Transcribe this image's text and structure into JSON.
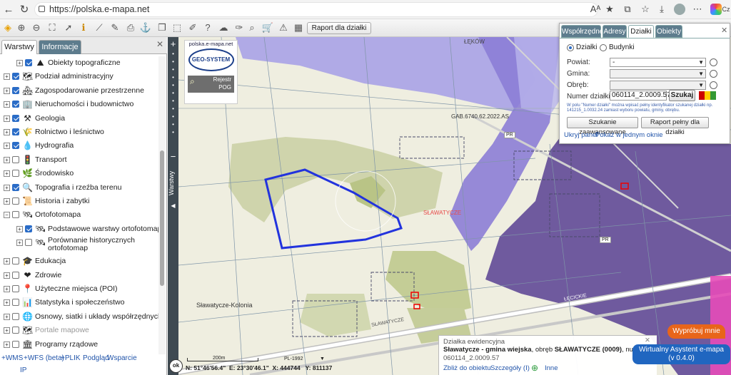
{
  "browser": {
    "url": "https://polska.e-mapa.net",
    "profile_label": "Cz"
  },
  "toolbar": {
    "raport_label": "Raport dla działki"
  },
  "left_panel": {
    "tabs": [
      "Warstwy",
      "Informacje"
    ],
    "layers": [
      {
        "label": "Obiekty topograficzne",
        "checked": true,
        "expander": "+",
        "icon": "⛰",
        "indent": 1
      },
      {
        "label": "Podział administracyjny",
        "checked": true,
        "expander": "+",
        "icon": "🗺",
        "indent": 0
      },
      {
        "label": "Zagospodarowanie przestrzenne",
        "checked": true,
        "expander": "+",
        "icon": "🏘",
        "indent": 0
      },
      {
        "label": "Nieruchomości i budownictwo",
        "checked": true,
        "expander": "+",
        "icon": "🏢",
        "indent": 0
      },
      {
        "label": "Geologia",
        "checked": true,
        "expander": "+",
        "icon": "⚒",
        "indent": 0
      },
      {
        "label": "Rolnictwo i leśnictwo",
        "checked": true,
        "expander": "+",
        "icon": "🌾",
        "indent": 0
      },
      {
        "label": "Hydrografia",
        "checked": true,
        "expander": "+",
        "icon": "💧",
        "indent": 0
      },
      {
        "label": "Transport",
        "checked": false,
        "expander": "+",
        "icon": "🚦",
        "indent": 0
      },
      {
        "label": "Środowisko",
        "checked": false,
        "expander": "+",
        "icon": "🌿",
        "indent": 0
      },
      {
        "label": "Topografia i rzeźba terenu",
        "checked": true,
        "expander": "+",
        "icon": "🔍",
        "indent": 0
      },
      {
        "label": "Historia i zabytki",
        "checked": false,
        "expander": "+",
        "icon": "📜",
        "indent": 0
      },
      {
        "label": "Ortofotomapa",
        "checked": false,
        "expander": "−",
        "icon": "🛰",
        "indent": 0
      },
      {
        "label": "Podstawowe warstwy ortofotomapy",
        "checked": true,
        "expander": "+",
        "icon": "🛰",
        "indent": 1
      },
      {
        "label": "Porównanie historycznych ortofotomap",
        "checked": false,
        "expander": "+",
        "icon": "🛰",
        "indent": 1,
        "two_line": true
      },
      {
        "label": "Edukacja",
        "checked": false,
        "expander": "+",
        "icon": "🎓",
        "indent": 0
      },
      {
        "label": "Zdrowie",
        "checked": false,
        "expander": "+",
        "icon": "❤",
        "indent": 0
      },
      {
        "label": "Użyteczne miejsca (POI)",
        "checked": false,
        "expander": "+",
        "icon": "📍",
        "indent": 0
      },
      {
        "label": "Statystyka i społeczeństwo",
        "checked": false,
        "expander": "+",
        "icon": "📊",
        "indent": 0
      },
      {
        "label": "Osnowy, siatki i układy współrzędnych",
        "checked": false,
        "expander": "+",
        "icon": "🌐",
        "indent": 0
      },
      {
        "label": "Portale mapowe",
        "checked": false,
        "expander": "+",
        "icon": "🗺",
        "indent": 0,
        "muted": true
      },
      {
        "label": "Programy rządowe",
        "checked": false,
        "expander": "+",
        "icon": "🏛",
        "indent": 0
      }
    ],
    "bottom_links": [
      "+WMS",
      "+WFS (beta)",
      "+PLIK",
      "Podgląd",
      "Wsparcie",
      "IP"
    ]
  },
  "vertical_tab": "Warstwy",
  "map": {
    "labels": {
      "town": "SŁAWATYCZE",
      "village": "Sławatycze-Kolonia",
      "ref": "GAB.6740.62.2022.AS",
      "road1": "PR",
      "road2": "PR",
      "road3": "SŁAWATYCZE",
      "road4": "ŁĘCICKIE",
      "top_place": "ŁĘKÓW"
    },
    "logo": {
      "site": "polska.e-mapa.net",
      "brand": "GEO-SYSTEM",
      "rejestr": "Rejestr",
      "pog": "POG"
    },
    "scale": "200m",
    "crs": "PL-1992",
    "coords": {
      "n": "N: 51°46'56.4\"",
      "e": "E: 23°30'46.1\"",
      "x": "X: 444744",
      "y": "Y: 811137"
    },
    "ok_label": "ok"
  },
  "right_panel": {
    "tabs": [
      "Współrzędne",
      "Adresy",
      "Działki",
      "Obiekty"
    ],
    "active_tab": "Działki",
    "radio_dzialki": "Działki",
    "radio_budynki": "Budynki",
    "fields": {
      "powiat_label": "Powiat:",
      "powiat_value": "-",
      "gmina_label": "Gmina:",
      "obreb_label": "Obręb:",
      "numer_label": "Numer działki:",
      "numer_value": "060114_2.0009.57"
    },
    "search_label": "Szukaj",
    "hint": "W polu \"Numer działki\" można wpisać pełny identyfikator szukanej działki np. 141215_1.0032.24 zamiast wyboru powiatu, gminy, obrębu.",
    "adv_label": "Szukanie zaawansowane",
    "report_label": "Raport pełny dla działki",
    "link_hide": "Ukryj panel",
    "link_window": "Pokaż w jednym oknie"
  },
  "info_popup": {
    "title": "Działka ewidencyjna",
    "line1_bold": "Sławatycze - gmina wiejska",
    "line1_rest": ", obręb ",
    "line1_bold2": "SŁAWATYCZE (0009)",
    "line1_tail": ", numer",
    "id": "060114_2.0009.57",
    "link_zoom": "Zbliż do obiektu",
    "link_details": "Szczegóły (I)",
    "link_more": "Inne"
  },
  "assistant": {
    "try_label": "Wypróbuj mnie",
    "title": "Wirtualny Asystent e-mapa",
    "version": "(v 0.4.0)"
  }
}
